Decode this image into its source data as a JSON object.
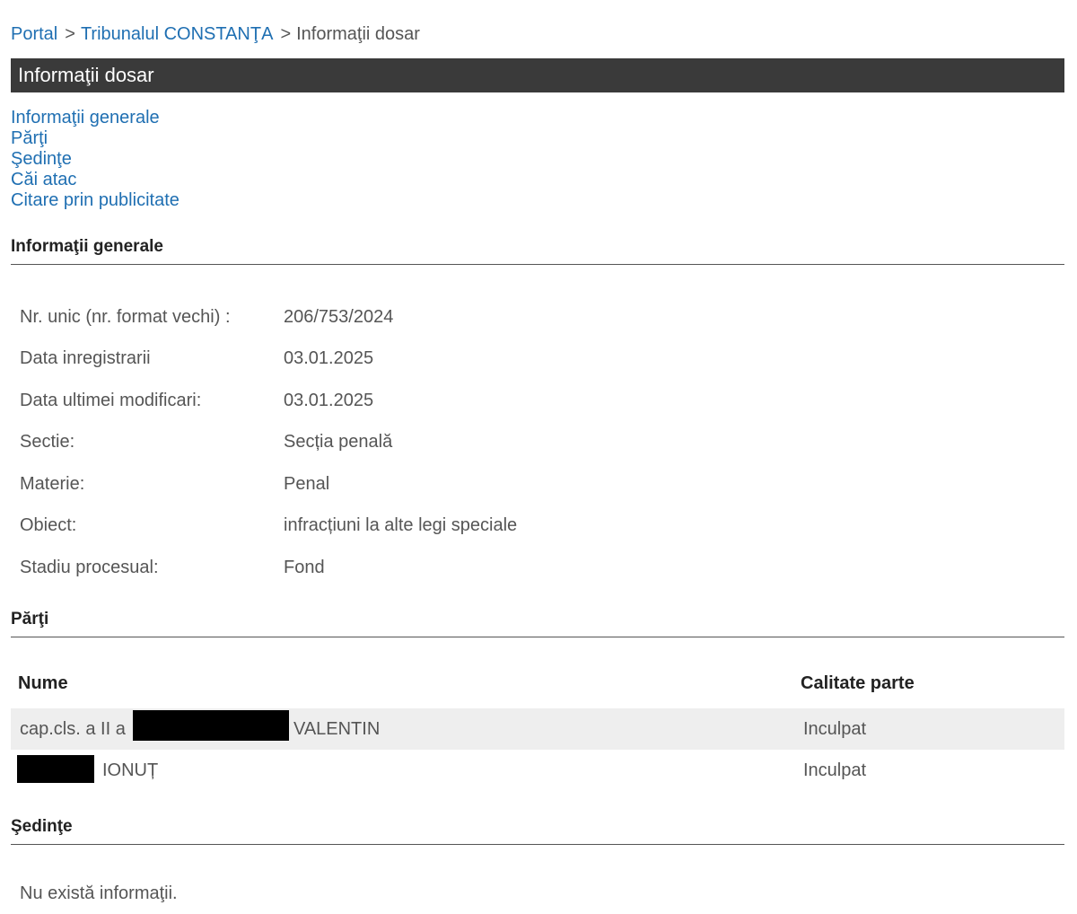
{
  "breadcrumb": {
    "portal": "Portal",
    "court": "Tribunalul CONSTANŢA",
    "current": "Informaţii dosar",
    "separator": ">"
  },
  "title": "Informaţii dosar",
  "anchor_links": [
    "Informaţii generale",
    "Părţi",
    "Şedinţe",
    "Căi atac",
    "Citare prin publicitate"
  ],
  "general_info": {
    "heading": "Informaţii generale",
    "rows": [
      {
        "label": "Nr. unic (nr. format vechi) :",
        "value": "206/753/2024"
      },
      {
        "label": "Data inregistrarii",
        "value": "03.01.2025"
      },
      {
        "label": "Data ultimei modificari:",
        "value": "03.01.2025"
      },
      {
        "label": "Sectie:",
        "value": "Secția penală"
      },
      {
        "label": "Materie:",
        "value": "Penal"
      },
      {
        "label": "Obiect:",
        "value": "infracțiuni la alte legi speciale"
      },
      {
        "label": "Stadiu procesual:",
        "value": "Fond"
      }
    ]
  },
  "parties": {
    "heading": "Părţi",
    "col_name": "Nume",
    "col_role": "Calitate parte",
    "rows": [
      {
        "name_prefix": "cap.cls. a II a",
        "name_suffix": "I VALENTIN",
        "role": "Inculpat"
      },
      {
        "name_prefix": "",
        "name_suffix": "IONUȚ",
        "role": "Inculpat"
      }
    ]
  },
  "hearings": {
    "heading": "Şedinţe",
    "empty_message": "Nu există informaţii."
  },
  "colors": {
    "link": "#1f6fb2",
    "title_bar": "#3a3a3a",
    "row_alt": "#eeeeee",
    "text": "#555555"
  }
}
